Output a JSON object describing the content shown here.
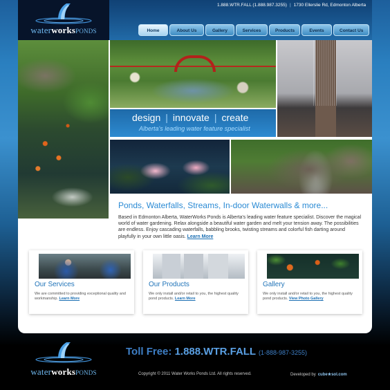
{
  "brand": {
    "logo_part1": "water",
    "logo_part2": "works",
    "logo_part3": "ponds"
  },
  "header": {
    "phone": "1.888.WTR.FALL (1.888.987.3255)",
    "address": "1730 Ellerslie Rd, Edmonton Alberta"
  },
  "nav": {
    "items": [
      {
        "label": "Home"
      },
      {
        "label": "About Us"
      },
      {
        "label": "Gallery"
      },
      {
        "label": "Services"
      },
      {
        "label": "Products"
      },
      {
        "label": "Events"
      },
      {
        "label": "Contact Us"
      }
    ]
  },
  "banner": {
    "word1": "design",
    "word2": "innovate",
    "word3": "create",
    "tagline": "Alberta's leading water feature specialist"
  },
  "intro": {
    "headline": "Ponds, Waterfalls, Streams, In-door Waterwalls & more...",
    "body": "Based in Edmonton Alberta, WaterWorks Ponds is Alberta's leading water feature specialist. Discover the magical world of water gardening. Relax alongside a beautiful water garden and melt your tension away. The possibilities are endless. Enjoy cascading waterfalls, babbling brooks, twisting streams and colorful fish darting around playfully in your own little oasis.",
    "link": "Learn More"
  },
  "cards": [
    {
      "title": "Our Services",
      "desc": "We are committed to providing exceptional quality and workmanship.",
      "link": "Learn More"
    },
    {
      "title": "Our Products",
      "desc": "We only install and/or retail to you, the highest quality pond products.",
      "link": "Learn More"
    },
    {
      "title": "Gallery",
      "desc": "We only install and/or retail to you, the highest quality pond products.",
      "link": "View Photo Gallery"
    }
  ],
  "footer": {
    "tollfree_label": "Toll Free:",
    "tollfree_number": "1.888.WTR.FALL",
    "tollfree_alt": "(1-888-987-3255)",
    "copyright": "Copyright © 2011 Water Works Ponds Ltd.  All rights reserved.",
    "developed_label": "Developed by",
    "developer": "cube★sol.com"
  },
  "colors": {
    "accent": "#2a8ad4",
    "link": "#1b6fb3",
    "header_dark": "#07142a"
  }
}
